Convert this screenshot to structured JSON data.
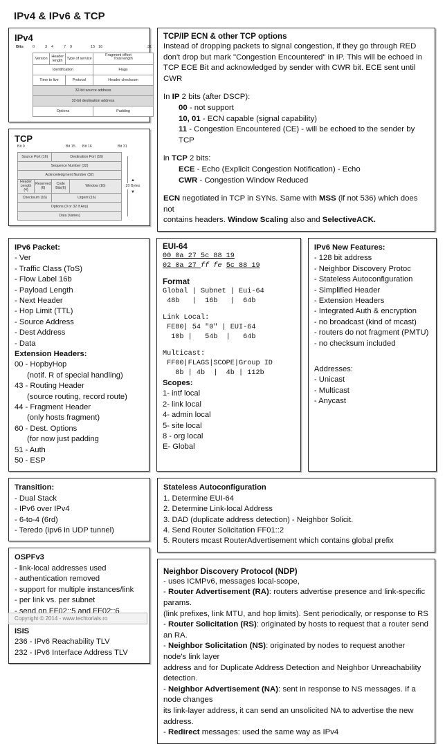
{
  "page": {
    "title": "IPv4 & IPv6 & TCP"
  },
  "ipv4": {
    "heading": "IPv4",
    "bits_label": "Bits",
    "bit_marks": [
      "0",
      "3",
      "4",
      "7",
      "9",
      "15",
      "16",
      "31"
    ],
    "fields": [
      "Version",
      "Header length",
      "Type of service",
      "Total length",
      "Identification",
      "Flags",
      "Fragment offset",
      "Time to live",
      "Protocol",
      "Header checksum",
      "32-bit source address",
      "32-bit destination address",
      "Options",
      "Padding"
    ]
  },
  "tcp": {
    "heading": "TCP",
    "bit_marks": [
      "Bit 0",
      "Bit 15",
      "Bit 16",
      "Bit 31"
    ],
    "size_note": "20 Bytes",
    "fields": [
      "Source Port (16)",
      "Destination Port (16)",
      "Sequence Number (32)",
      "Acknowledgment Number (32)",
      "Header Length (4)",
      "Reserved (6)",
      "Code Bits(6)",
      "Window (16)",
      "Checksum (16)",
      "Urgent (16)",
      "Options (0 or 32 If Any)",
      "Data (Varies)"
    ]
  },
  "ecn": {
    "heading": "TCP/IP ECN & other TCP options",
    "intro": [
      "Instead of dropping packets to signal congestion, if they go through RED",
      "don't drop but mark \"Congestion Encountered\" in IP. This will be echoed in",
      "TCP ECE Bit and acknowledged by sender with CWR bit. ECE sent until CWR"
    ],
    "ip_heading_pre": "In ",
    "ip_heading_b": "IP",
    "ip_heading_post": " 2 bits (after DSCP):",
    "ip_bits": [
      {
        "code": "00",
        "desc": " - not support"
      },
      {
        "code": "10, 01",
        "desc": " - ECN capable (signal capability)"
      },
      {
        "code": "11",
        "desc": " - Congestion Encountered (CE) - will be echoed to the sender by TCP"
      }
    ],
    "tcp_heading_pre": "in ",
    "tcp_heading_b": "TCP",
    "tcp_heading_post": " 2 bits:",
    "tcp_bits": [
      {
        "code": "ECE",
        "desc": " - Echo (Explicit Congestion Notification) - Echo"
      },
      {
        "code": "CWR",
        "desc": " - Congestion Window Reduced"
      }
    ],
    "outro_1_b": "ECN",
    "outro_1": " negotiated in TCP in SYNs. Same with ",
    "outro_2_b": "MSS",
    "outro_2": " (if not 536) which does not",
    "outro_3": "contains headers. ",
    "outro_3_b": "Window Scaling",
    "outro_4": " also and ",
    "outro_4_b": "SelectiveACK.",
    "outro_end": ""
  },
  "ipv6_packet": {
    "heading": "IPv6 Packet:",
    "items": [
      "- Ver",
      "- Traffic Class (ToS)",
      "- Flow Label 16b",
      "- Payload Length",
      "- Next Header",
      "- Hop Limit (TTL)",
      "- Source Address",
      "- Dest Address",
      "- Data"
    ],
    "ext_heading": "Extension Headers:",
    "ext_items": [
      {
        "text": "00 - HopbyHop",
        "indent": false
      },
      {
        "text": "(notif. R of special handling)",
        "indent": true
      },
      {
        "text": "43 - Routing Header",
        "indent": false
      },
      {
        "text": "(source routing, record route)",
        "indent": true
      },
      {
        "text": "44 - Fragment Header",
        "indent": false
      },
      {
        "text": "(only hosts fragment)",
        "indent": true
      },
      {
        "text": "60 - Dest. Options",
        "indent": false
      },
      {
        "text": "(for now just padding",
        "indent": true
      },
      {
        "text": "51 - Auth",
        "indent": false
      },
      {
        "text": "50 - ESP",
        "indent": false
      }
    ]
  },
  "eui64": {
    "heading": "EUI-64",
    "mac_line_1": {
      "a": "00",
      "b": " 0a 27 ",
      "c": "5c 88 19"
    },
    "mac_line_2": {
      "a": "02",
      "b": " 0a 27 ",
      "mid": "ff fe ",
      "c": "5c 88 19"
    },
    "format_heading": "Format",
    "format_lines": [
      "Global | Subnet | Eui-64",
      " 48b   |  16b   |  64b"
    ],
    "linklocal_heading": "Link Local:",
    "linklocal_lines": [
      " FE80| 54 \"0\" | EUI-64",
      "  10b |   54b  |   64b"
    ],
    "multicast_heading": "Multicast:",
    "multicast_lines": [
      " FF00|FLAGS|SCOPE|Group ID",
      "   8b | 4b  |  4b | 112b"
    ],
    "scopes_heading": "Scopes:",
    "scopes": [
      "1- intf local",
      "2- link local",
      "4- admin local",
      "5- site local",
      "8 - org local",
      "E- Global"
    ]
  },
  "ipv6_features": {
    "heading": "IPv6 New Features:",
    "items": [
      "- 128 bit address",
      "- Neighbor Discovery Protoc",
      "- Stateless Autoconfiguration",
      "- Simplified Header",
      "- Extension Headers",
      "- Integrated Auth & encryption",
      "- no broadcast (kind of mcast)",
      "- routers do not fragment (PMTU)",
      "- no checksum included"
    ],
    "addr_heading": "Addresses:",
    "addr_items": [
      "- Unicast",
      "- Multicast",
      "- Anycast"
    ]
  },
  "transition": {
    "heading": "Transition:",
    "items": [
      "- Dual Stack",
      "- IPv6 over IPv4",
      "- 6-to-4 (6rd)",
      "- Teredo (ipv6 in UDP tunnel)"
    ]
  },
  "ospf": {
    "heading": "OSPFv3",
    "items": [
      "- link-local addresses used",
      "- authentication removed",
      "- support for multiple instances/link",
      "- per link vs. per subnet",
      "- send on FF02::5 and FF02::6"
    ],
    "isis_heading": "ISIS",
    "isis_items": [
      "236 - IPv6 Reachability TLV",
      "232 - IPv6 Interface Address TLV"
    ]
  },
  "slaac": {
    "heading": "Stateless Autoconfiguration",
    "steps": [
      "1. Determine EUI-64",
      "2. Determine Link-local Address",
      "3. DAD (duplicate address detection) - Neighbor Solicit.",
      "4. Send Router Solicitation FF01::2",
      "5. Routers mcast RouterAdvertisement which contains global prefix"
    ]
  },
  "ndp": {
    "heading": "Neighbor Discovery Protocol (NDP)",
    "entries": [
      {
        "lead": "",
        "bold": "",
        "rest": "- uses ICMPv6, messages local-scope,"
      },
      {
        "lead": "- ",
        "bold": "Router Advertisement (RA)",
        "rest": ": routers advertise presence and link-specific params."
      },
      {
        "lead": "",
        "bold": "",
        "rest": "(link prefixes, link MTU, and hop limits). Sent periodically, or response to RS"
      },
      {
        "lead": "- ",
        "bold": "Router Solicitation (RS)",
        "rest": ": originated by hosts to request that a router send an RA."
      },
      {
        "lead": "- ",
        "bold": "Neighbor Solicitation (NS)",
        "rest": ": originated by nodes to request another node's link layer"
      },
      {
        "lead": "",
        "bold": "",
        "rest": "address and for Duplicate Address Detection and Neighbor Unreachability detection."
      },
      {
        "lead": "- ",
        "bold": "Neighbor Advertisement (NA)",
        "rest": ": sent in response to NS messages. If a node changes"
      },
      {
        "lead": "",
        "bold": "",
        "rest": "its link-layer address, it can send an unsolicited NA to advertise the new address."
      },
      {
        "lead": "- ",
        "bold": "Redirect",
        "rest": " messages: used the same way as IPv4"
      }
    ]
  },
  "footer": {
    "text": "Copyright © 2014 - www.techtorials.ro"
  }
}
